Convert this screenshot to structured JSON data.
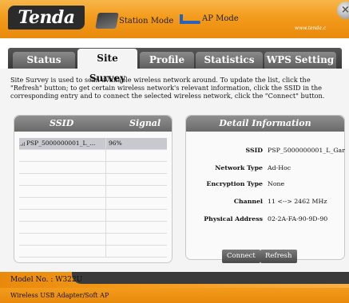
{
  "header": {
    "logo": "Tenda",
    "modes": [
      {
        "label": "Station Mode",
        "icon": "station-mode-icon"
      },
      {
        "label": "AP Mode",
        "icon": "ap-mode-icon"
      }
    ],
    "url": "www.tenda.c",
    "close_icon": "close-icon"
  },
  "tabs": [
    {
      "label": "Status",
      "active": false
    },
    {
      "label": "Site Survey",
      "active": true
    },
    {
      "label": "Profile",
      "active": false
    },
    {
      "label": "Statistics",
      "active": false
    },
    {
      "label": "WPS Setting",
      "active": false
    }
  ],
  "description": "Site Survey is used to scan available wireless network around. To update the list, click the \"Refresh\" button; to get certain wireless network's relevant information, click the SSID in the corresponding entry and to connect the selected wireless network, click the \"Connect\" button.",
  "networks": {
    "headers": {
      "ssid": "SSID",
      "signal": "Signal"
    },
    "rows": [
      {
        "ssid": "PSP_5000000001_L_...",
        "signal": "96%",
        "selected": true
      }
    ]
  },
  "detail": {
    "header": "Detail Information",
    "fields": [
      {
        "label": "SSID",
        "value": "PSP_5000000001_L_Gar"
      },
      {
        "label": "Network Type",
        "value": "Ad-Hoc"
      },
      {
        "label": "Encryption Type",
        "value": "None"
      },
      {
        "label": "Channel",
        "value": "11 <--> 2462 MHz"
      },
      {
        "label": "Physical Address",
        "value": "02-2A-FA-90-9D-90"
      }
    ]
  },
  "buttons": {
    "connect": "Connect",
    "refresh": "Refresh"
  },
  "footer": {
    "model": "Model No. : W322U",
    "description": "Wireless USB Adapter/Soft AP"
  },
  "colors": {
    "accent": "#f39b1c",
    "dark": "#3a3a3a",
    "selected_row": "#c7c9cf"
  }
}
